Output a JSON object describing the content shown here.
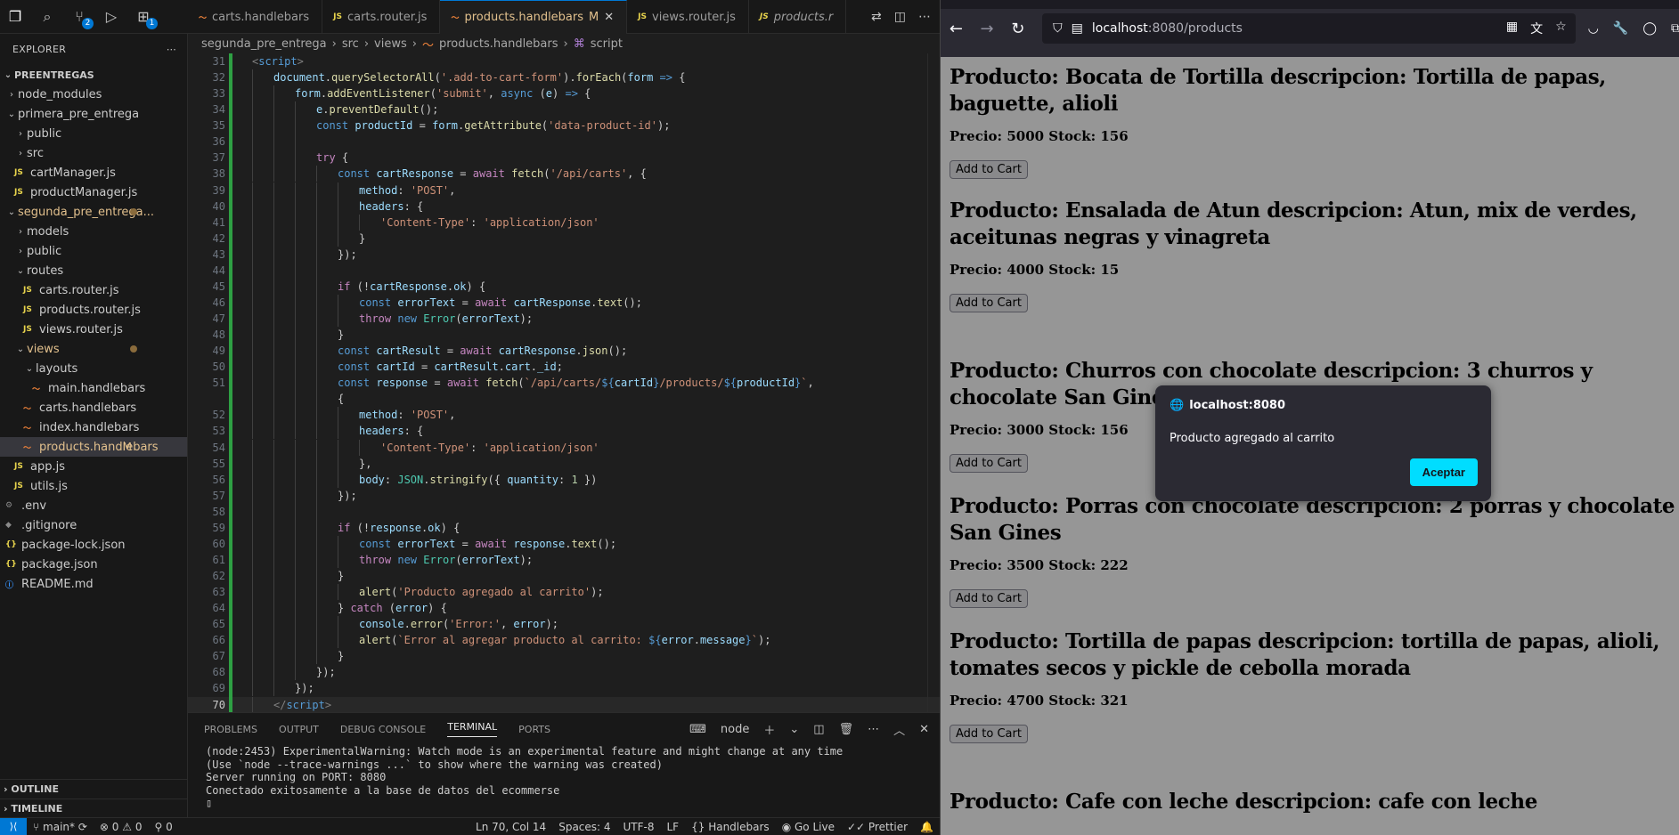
{
  "vscode": {
    "tabs": [
      {
        "label": "carts.handlebars",
        "type": "hbs"
      },
      {
        "label": "carts.router.js",
        "type": "js"
      },
      {
        "label": "products.handlebars",
        "type": "hbs",
        "badge": "M",
        "active": true
      },
      {
        "label": "views.router.js",
        "type": "js"
      },
      {
        "label": "products.r",
        "type": "js",
        "italic": true
      }
    ],
    "activity_badges": {
      "scm": "2",
      "extensions": "1"
    },
    "explorer": {
      "title": "EXPLORER",
      "root": "PREENTREGAS",
      "items": [
        {
          "label": "node_modules",
          "depth": 1,
          "kind": "folder-closed"
        },
        {
          "label": "primera_pre_entrega",
          "depth": 1,
          "kind": "folder-open"
        },
        {
          "label": "public",
          "depth": 2,
          "kind": "folder-closed"
        },
        {
          "label": "src",
          "depth": 2,
          "kind": "folder-closed"
        },
        {
          "label": "cartManager.js",
          "depth": 2,
          "kind": "js"
        },
        {
          "label": "productManager.js",
          "depth": 2,
          "kind": "js"
        },
        {
          "label": "segunda_pre_entrega...",
          "depth": 1,
          "kind": "folder-open",
          "modified": true
        },
        {
          "label": "models",
          "depth": 2,
          "kind": "folder-closed"
        },
        {
          "label": "public",
          "depth": 2,
          "kind": "folder-closed"
        },
        {
          "label": "routes",
          "depth": 2,
          "kind": "folder-open"
        },
        {
          "label": "carts.router.js",
          "depth": 3,
          "kind": "js"
        },
        {
          "label": "products.router.js",
          "depth": 3,
          "kind": "js"
        },
        {
          "label": "views.router.js",
          "depth": 3,
          "kind": "js"
        },
        {
          "label": "views",
          "depth": 2,
          "kind": "folder-open",
          "modified": true
        },
        {
          "label": "layouts",
          "depth": 3,
          "kind": "folder-open"
        },
        {
          "label": "main.handlebars",
          "depth": 4,
          "kind": "hbs"
        },
        {
          "label": "carts.handlebars",
          "depth": 3,
          "kind": "hbs"
        },
        {
          "label": "index.handlebars",
          "depth": 3,
          "kind": "hbs"
        },
        {
          "label": "products.handlebars",
          "depth": 3,
          "kind": "hbs",
          "modified": true,
          "badge": "M",
          "selected": true
        },
        {
          "label": "app.js",
          "depth": 2,
          "kind": "js"
        },
        {
          "label": "utils.js",
          "depth": 2,
          "kind": "js"
        },
        {
          "label": ".env",
          "depth": 1,
          "kind": "gear"
        },
        {
          "label": ".gitignore",
          "depth": 1,
          "kind": "git"
        },
        {
          "label": "package-lock.json",
          "depth": 1,
          "kind": "json"
        },
        {
          "label": "package.json",
          "depth": 1,
          "kind": "json"
        },
        {
          "label": "README.md",
          "depth": 1,
          "kind": "info"
        }
      ],
      "outline": "OUTLINE",
      "timeline": "TIMELINE"
    },
    "breadcrumb": [
      "segunda_pre_entrega",
      "src",
      "views",
      "products.handlebars",
      "script"
    ],
    "code_lines": [
      {
        "n": "31",
        "html": "<span class='tagb'>&lt;</span><span class='tag'>script</span><span class='tagb'>&gt;</span>",
        "indent": 0
      },
      {
        "n": "32",
        "html": "<span class='var'>document</span>.<span class='fn'>querySelectorAll</span>(<span class='str'>'.add-to-cart-form'</span>).<span class='fn'>forEach</span>(<span class='var'>form</span> <span class='k'>=&gt;</span> {",
        "indent": 1
      },
      {
        "n": "33",
        "html": "<span class='var'>form</span>.<span class='fn'>addEventListener</span>(<span class='str'>'submit'</span>, <span class='k'>async</span> (<span class='var'>e</span>) <span class='k'>=&gt;</span> {",
        "indent": 2
      },
      {
        "n": "34",
        "html": "<span class='var'>e</span>.<span class='fn'>preventDefault</span>();",
        "indent": 3
      },
      {
        "n": "35",
        "html": "<span class='k'>const</span> <span class='var'>productId</span> = <span class='var'>form</span>.<span class='fn'>getAttribute</span>(<span class='str'>'data-product-id'</span>);",
        "indent": 3
      },
      {
        "n": "36",
        "html": "",
        "indent": 3
      },
      {
        "n": "37",
        "html": "<span class='kc'>try</span> {",
        "indent": 3
      },
      {
        "n": "38",
        "html": "<span class='k'>const</span> <span class='var'>cartResponse</span> = <span class='kc'>await</span> <span class='fn'>fetch</span>(<span class='str'>'/api/carts'</span>, {",
        "indent": 4
      },
      {
        "n": "39",
        "html": "<span class='var'>method</span>: <span class='str'>'POST'</span>,",
        "indent": 5
      },
      {
        "n": "40",
        "html": "<span class='var'>headers</span>: {",
        "indent": 5
      },
      {
        "n": "41",
        "html": "<span class='str'>'Content-Type'</span>: <span class='str'>'application/json'</span>",
        "indent": 6
      },
      {
        "n": "42",
        "html": "}",
        "indent": 5
      },
      {
        "n": "43",
        "html": "});",
        "indent": 4
      },
      {
        "n": "44",
        "html": "",
        "indent": 4
      },
      {
        "n": "45",
        "html": "<span class='kc'>if</span> (!<span class='var'>cartResponse</span>.<span class='var'>ok</span>) {",
        "indent": 4
      },
      {
        "n": "46",
        "html": "<span class='k'>const</span> <span class='var'>errorText</span> = <span class='kc'>await</span> <span class='var'>cartResponse</span>.<span class='fn'>text</span>();",
        "indent": 5
      },
      {
        "n": "47",
        "html": "<span class='kc'>throw</span> <span class='k'>new</span> <span class='cls'>Error</span>(<span class='var'>errorText</span>);",
        "indent": 5
      },
      {
        "n": "48",
        "html": "}",
        "indent": 4
      },
      {
        "n": "49",
        "html": "<span class='k'>const</span> <span class='var'>cartResult</span> = <span class='kc'>await</span> <span class='var'>cartResponse</span>.<span class='fn'>json</span>();",
        "indent": 4
      },
      {
        "n": "50",
        "html": "<span class='k'>const</span> <span class='var'>cartId</span> = <span class='var'>cartResult</span>.<span class='var'>cart</span>.<span class='var'>_id</span>;",
        "indent": 4
      },
      {
        "n": "51",
        "html": "<span class='k'>const</span> <span class='var'>response</span> = <span class='kc'>await</span> <span class='fn'>fetch</span>(<span class='str'>`/api/carts/</span><span class='k'>${</span><span class='var'>cartId</span><span class='k'>}</span><span class='str'>/products/</span><span class='k'>${</span><span class='var'>productId</span><span class='k'>}</span><span class='str'>`</span>,",
        "indent": 4
      },
      {
        "n": "",
        "html": "{",
        "indent": 4
      },
      {
        "n": "52",
        "html": "<span class='var'>method</span>: <span class='str'>'POST'</span>,",
        "indent": 5
      },
      {
        "n": "53",
        "html": "<span class='var'>headers</span>: {",
        "indent": 5
      },
      {
        "n": "54",
        "html": "<span class='str'>'Content-Type'</span>: <span class='str'>'application/json'</span>",
        "indent": 6
      },
      {
        "n": "55",
        "html": "},",
        "indent": 5
      },
      {
        "n": "56",
        "html": "<span class='var'>body</span>: <span class='cls'>JSON</span>.<span class='fn'>stringify</span>({ <span class='var'>quantity</span>: <span class='num'>1</span> })",
        "indent": 5
      },
      {
        "n": "57",
        "html": "});",
        "indent": 4
      },
      {
        "n": "58",
        "html": "",
        "indent": 4
      },
      {
        "n": "59",
        "html": "<span class='kc'>if</span> (!<span class='var'>response</span>.<span class='var'>ok</span>) {",
        "indent": 4
      },
      {
        "n": "60",
        "html": "<span class='k'>const</span> <span class='var'>errorText</span> = <span class='kc'>await</span> <span class='var'>response</span>.<span class='fn'>text</span>();",
        "indent": 5
      },
      {
        "n": "61",
        "html": "<span class='kc'>throw</span> <span class='k'>new</span> <span class='cls'>Error</span>(<span class='var'>errorText</span>);",
        "indent": 5
      },
      {
        "n": "62",
        "html": "}",
        "indent": 4
      },
      {
        "n": "63",
        "html": "<span class='fn'>alert</span>(<span class='str'>'Producto agregado al carrito'</span>);",
        "indent": 5
      },
      {
        "n": "64",
        "html": "} <span class='kc'>catch</span> (<span class='var'>error</span>) {",
        "indent": 4
      },
      {
        "n": "65",
        "html": "<span class='var'>console</span>.<span class='fn'>error</span>(<span class='str'>'Error:'</span>, <span class='var'>error</span>);",
        "indent": 5
      },
      {
        "n": "66",
        "html": "<span class='fn'>alert</span>(<span class='str'>`Error al agregar producto al carrito: </span><span class='k'>${</span><span class='var'>error</span>.<span class='var'>message</span><span class='k'>}</span><span class='str'>`</span>);",
        "indent": 5
      },
      {
        "n": "67",
        "html": "}",
        "indent": 4
      },
      {
        "n": "68",
        "html": "});",
        "indent": 3
      },
      {
        "n": "69",
        "html": "});",
        "indent": 2
      },
      {
        "n": "70",
        "html": "<span class='tagb'>&lt;/</span><span class='tag'>script</span><span class='tagb'>&gt;</span>",
        "indent": 1,
        "current": true
      }
    ],
    "panel": {
      "tabs": [
        "PROBLEMS",
        "OUTPUT",
        "DEBUG CONSOLE",
        "TERMINAL",
        "PORTS"
      ],
      "active_tab": "TERMINAL",
      "terminal_name": "node",
      "terminal_lines": [
        "(node:2453) ExperimentalWarning: Watch mode is an experimental feature and might change at any time",
        "(Use `node --trace-warnings ...` to show where the warning was created)",
        "Server running on PORT: 8080",
        "Conectado exitosamente a la base de datos del ecommerse",
        "▯"
      ]
    },
    "statusbar": {
      "branch": "main*",
      "errors": "0",
      "warnings": "0",
      "ports": "0",
      "position": "Ln 70, Col 14",
      "spaces": "Spaces: 4",
      "encoding": "UTF-8",
      "eol": "LF",
      "language": "Handlebars",
      "golive": "Go Live",
      "prettier": "Prettier"
    }
  },
  "browser": {
    "url_host": "localhost",
    "url_rest": ":8080/products",
    "products": [
      {
        "title": "Producto: Bocata de Tortilla   descripcion: Tortilla de papas, baguette, alioli",
        "meta": "Precio: 5000   Stock: 156",
        "button": "Add to Cart"
      },
      {
        "title": "Producto: Ensalada de Atun   descripcion: Atun, mix de verdes, aceitunas negras y vinagreta",
        "meta": "Precio: 4000   Stock: 15",
        "button": "Add to Cart"
      },
      {
        "title": "Producto: Churros con chocolate   descripcion: 3 churros y chocolate San Gines",
        "meta": "Precio: 3000   Stock: 156",
        "button": "Add to Cart"
      },
      {
        "title": "Producto: Porras con chocolate   descripcion: 2 porras y chocolate San Gines",
        "meta": "Precio: 3500   Stock: 222",
        "button": "Add to Cart"
      },
      {
        "title": "Producto: Tortilla de papas   descripcion: tortilla de papas, alioli, tomates secos y pickle de cebolla morada",
        "meta": "Precio: 4700   Stock: 321",
        "button": "Add to Cart"
      },
      {
        "title": "Producto: Cafe con leche   descripcion: cafe con leche",
        "meta": "",
        "button": ""
      }
    ],
    "dialog": {
      "origin": "localhost:8080",
      "message": "Producto agregado al carrito",
      "button": "Aceptar"
    }
  }
}
